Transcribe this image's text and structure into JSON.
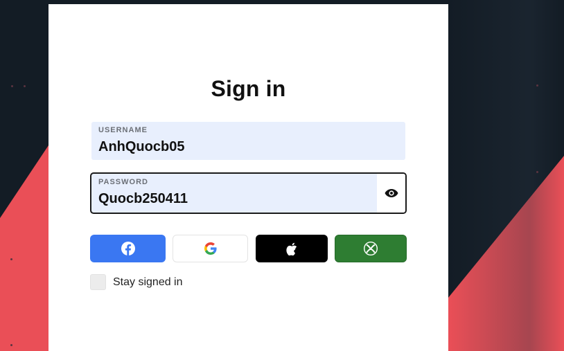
{
  "signin": {
    "title": "Sign in",
    "username": {
      "label": "USERNAME",
      "value": "AnhQuocb05"
    },
    "password": {
      "label": "PASSWORD",
      "value": "Quocb250411"
    },
    "social": [
      {
        "provider": "Facebook",
        "icon": "facebook-icon",
        "color": "#3a77f2"
      },
      {
        "provider": "Google",
        "icon": "google-icon",
        "color": "#ffffff"
      },
      {
        "provider": "Apple",
        "icon": "apple-icon",
        "color": "#000000"
      },
      {
        "provider": "Xbox",
        "icon": "xbox-icon",
        "color": "#2e7d32"
      }
    ],
    "stay_signed_in": {
      "label": "Stay signed in",
      "checked": false
    }
  },
  "colors": {
    "accent_red": "#ea4f57",
    "background": "#131c25",
    "field_bg": "#e8effd"
  }
}
